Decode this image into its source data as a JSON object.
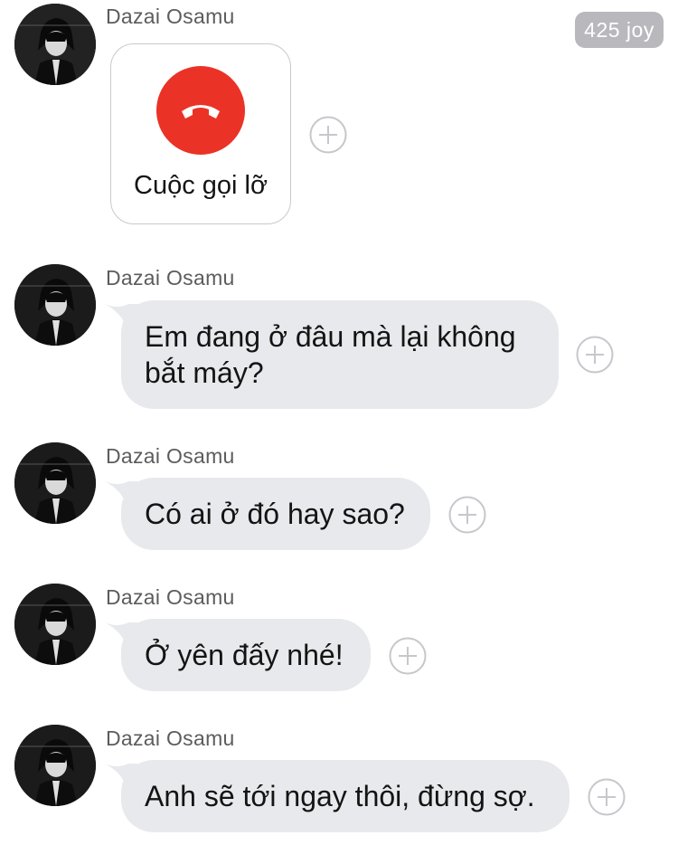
{
  "counter_badge": "425 joy",
  "colors": {
    "bubble_bg": "#e8e9ec",
    "call_red": "#ea3326",
    "badge_bg": "#b8b8bd",
    "sender_text": "#5c5c5c"
  },
  "missed_call": {
    "sender": "Dazai Osamu",
    "icon": "hangup-phone-icon",
    "label": "Cuộc gọi lỡ"
  },
  "messages": [
    {
      "sender": "Dazai Osamu",
      "text_lines": [
        "Em đang ở đâu mà lại không",
        "bắt máy?"
      ]
    },
    {
      "sender": "Dazai Osamu",
      "text_lines": [
        "Có ai ở đó hay sao?"
      ]
    },
    {
      "sender": "Dazai Osamu",
      "text_lines": [
        "Ở yên đấy nhé!"
      ]
    },
    {
      "sender": "Dazai Osamu",
      "text_lines": [
        "Anh sẽ tới ngay thôi, đừng sợ."
      ]
    }
  ],
  "reaction_icon": "add-reaction-plus-icon"
}
